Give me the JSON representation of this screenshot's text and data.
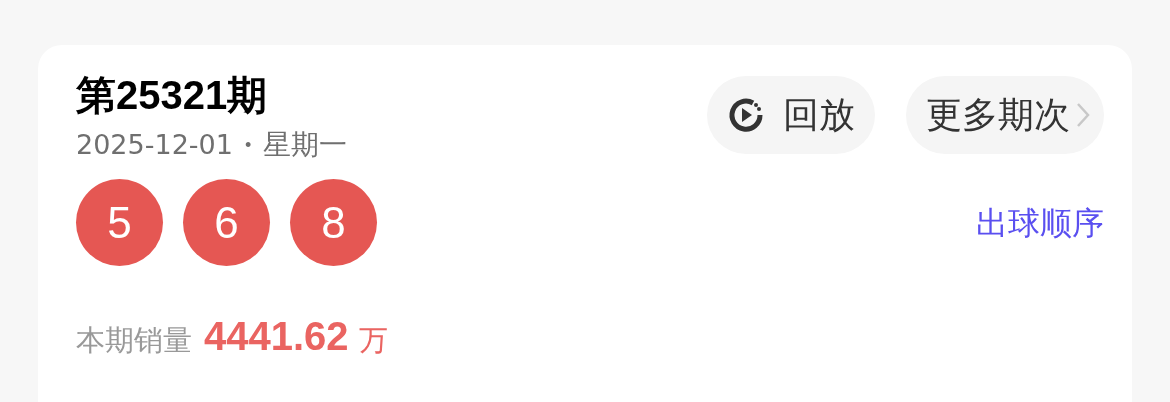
{
  "draw": {
    "title": "第25321期",
    "date": "2025-12-01",
    "separator": "•",
    "weekday": "星期一",
    "buttons": [
      {
        "kind": "replay",
        "label": "回放"
      },
      {
        "kind": "more",
        "label": "更多期次"
      }
    ],
    "balls": [
      "5",
      "6",
      "8"
    ],
    "order_link": "出球顺序",
    "sales": {
      "label": "本期销量",
      "value": "4441.62",
      "unit": "万"
    }
  }
}
